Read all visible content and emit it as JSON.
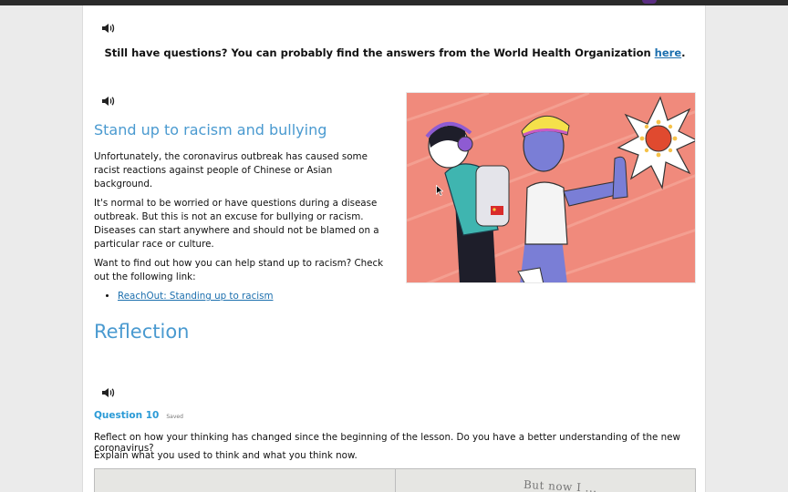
{
  "colors": {
    "heading": "#4a9ad0",
    "link": "#1c6fae",
    "question": "#2a9ad6",
    "illustration_bg": "#f08a7c"
  },
  "icons": {
    "speaker": "speaker-icon",
    "cursor": "mouse-pointer-icon"
  },
  "notice": {
    "text": "Still have questions? You can probably find the answers from the World Health Organization ",
    "link_label": "here",
    "suffix": "."
  },
  "racism_section": {
    "title": "Stand up to racism and bullying",
    "paragraphs": [
      "Unfortunately, the coronavirus outbreak has caused some racist reactions against people of Chinese or Asian background.",
      "It's normal to be worried or have questions during a disease outbreak. But this is not an excuse for bullying or racism. Diseases can start anywhere and should not be blamed on a particular race or culture.",
      "Want to find out how you can help stand up to racism? Check out the following link:"
    ],
    "link_label": "ReachOut: Standing up to racism"
  },
  "reflection": {
    "title": "Reflection",
    "question_label": "Question 10",
    "saved_label": "Saved",
    "prompt_1": "Reflect on how your thinking has changed since the beginning of the lesson. Do you have a better understanding of the new coronavirus?",
    "prompt_2": "Explain what you used to think and what you think now.",
    "answer_right_text": "But now I ..."
  }
}
